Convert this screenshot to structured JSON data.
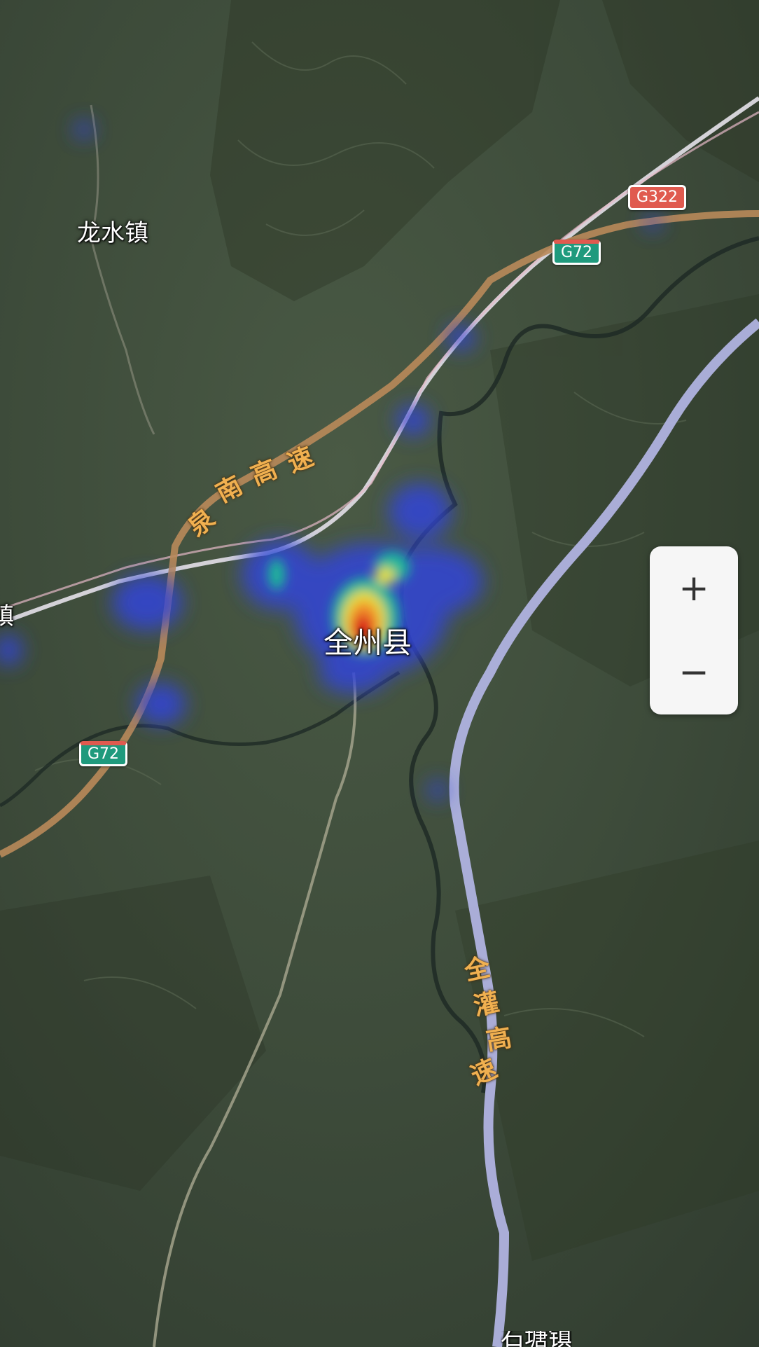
{
  "map": {
    "places": {
      "longshui": "龙水镇",
      "quanzhou": "全州县",
      "left_edge": "镇",
      "bottom_town": "石塘镇"
    },
    "shields": {
      "g322": "G322",
      "g72_top": "G72",
      "g72_left": "G72"
    },
    "expressways": {
      "quannan": [
        "泉",
        "南",
        "高",
        "速"
      ],
      "quanguan": [
        "全",
        "灌",
        "高",
        "速"
      ]
    },
    "heatmap_legend_colors": [
      "#3044d8",
      "#1fb89a",
      "#e8e03a",
      "#f08a2a",
      "#d81f1f"
    ]
  },
  "zoom": {
    "in_label": "+",
    "out_label": "−"
  }
}
